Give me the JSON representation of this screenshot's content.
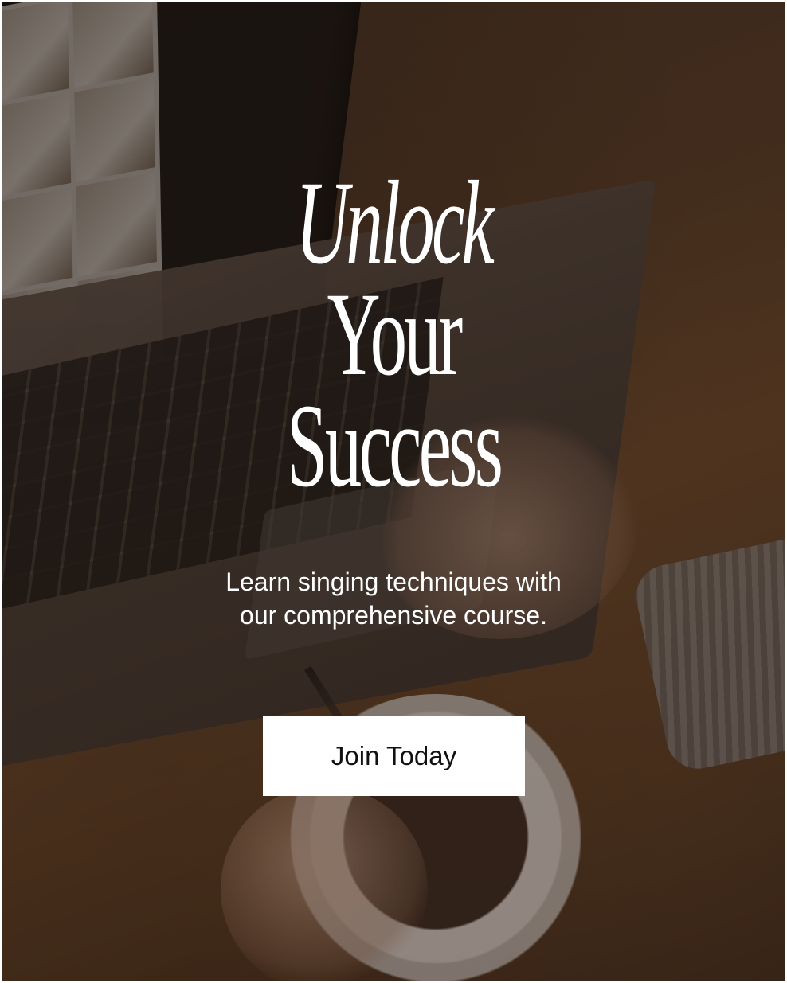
{
  "hero": {
    "headline_lines": [
      "Unlock",
      "Your",
      "Success"
    ],
    "subtitle_lines": [
      "Learn singing techniques with",
      "our comprehensive course."
    ],
    "cta_label": "Join Today"
  },
  "colors": {
    "text": "#ffffff",
    "button_bg": "#ffffff",
    "button_text": "#111111"
  }
}
